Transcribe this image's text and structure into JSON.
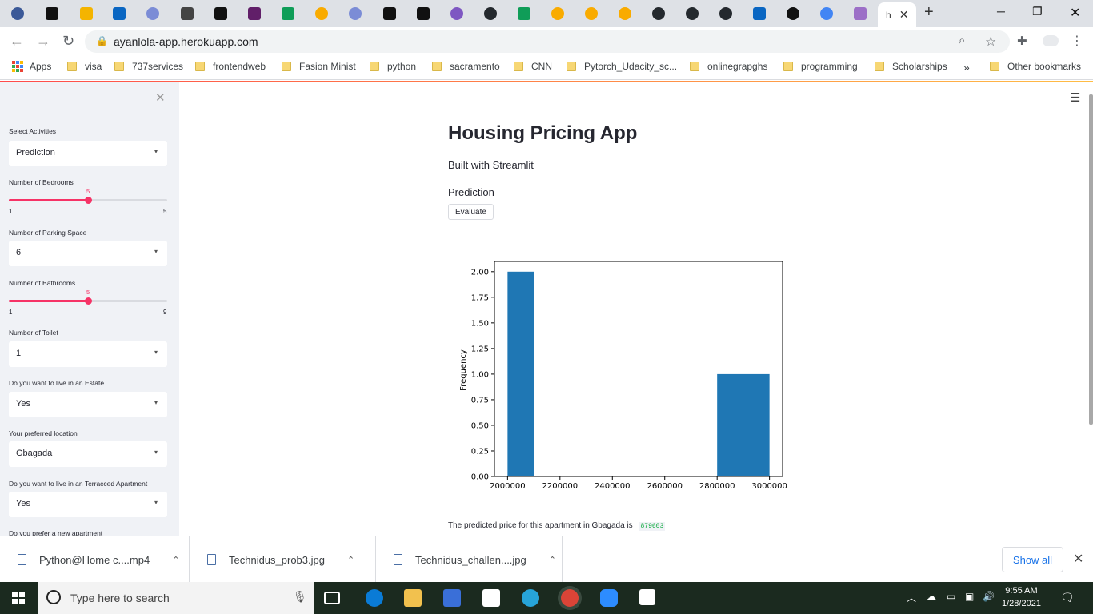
{
  "browser": {
    "active_tab_label": "h",
    "url": "ayanlola-app.herokuapp.com",
    "bookmarks": [
      "Apps",
      "visa",
      "737services",
      "frontendweb",
      "Fasion Minist",
      "python",
      "sacramento",
      "CNN",
      "Pytorch_Udacity_sc...",
      "onlinegrapghs",
      "programming",
      "Scholarships",
      "Other bookmarks"
    ],
    "bookmarks_overflow": "»"
  },
  "sidebar": {
    "activity_label": "Select Activities",
    "activity_value": "Prediction",
    "bedrooms_label": "Number of Bedrooms",
    "bedrooms": {
      "value": "5",
      "min": "1",
      "max": "5",
      "fraction": 0.5
    },
    "parking_label": "Number of Parking Space",
    "parking_value": "6",
    "bathrooms_label": "Number of Bathrooms",
    "bathrooms": {
      "value": "5",
      "min": "1",
      "max": "9",
      "fraction": 0.5
    },
    "toilet_label": "Number of Toilet",
    "toilet_value": "1",
    "estate_label": "Do you want to live in an Estate",
    "estate_value": "Yes",
    "location_label": "Your preferred location",
    "location_value": "Gbagada",
    "terraced_label": "Do you want to live in an Terracced Apartment",
    "terraced_value": "Yes",
    "new_apartment_label": "Do you prefer a new apartment"
  },
  "main": {
    "title": "Housing Pricing App",
    "subtitle": "Built with Streamlit",
    "section": "Prediction",
    "evaluate_label": "Evaluate",
    "result_text": "The predicted price for this apartment in Gbagada is",
    "result_value": "879603"
  },
  "chart_data": {
    "type": "bar",
    "title": "",
    "xlabel": "",
    "ylabel": "Frequency",
    "xlim": [
      1950000,
      3050000
    ],
    "ylim": [
      0,
      2.1
    ],
    "x_ticks": [
      "2000000",
      "2200000",
      "2400000",
      "2600000",
      "2800000",
      "3000000"
    ],
    "y_ticks": [
      "0.00",
      "0.25",
      "0.50",
      "0.75",
      "1.00",
      "1.25",
      "1.50",
      "1.75",
      "2.00"
    ],
    "bins": [
      {
        "start": 2000000,
        "end": 2100000,
        "value": 2
      },
      {
        "start": 2800000,
        "end": 3000000,
        "value": 1
      }
    ],
    "bar_color": "#1f77b4"
  },
  "downloads": {
    "items": [
      "Python@Home c....mp4",
      "Technidus_prob3.jpg",
      "Technidus_challen....jpg"
    ],
    "show_all": "Show all"
  },
  "taskbar": {
    "search_placeholder": "Type here to search",
    "time": "9:55 AM",
    "date": "1/28/2021"
  }
}
